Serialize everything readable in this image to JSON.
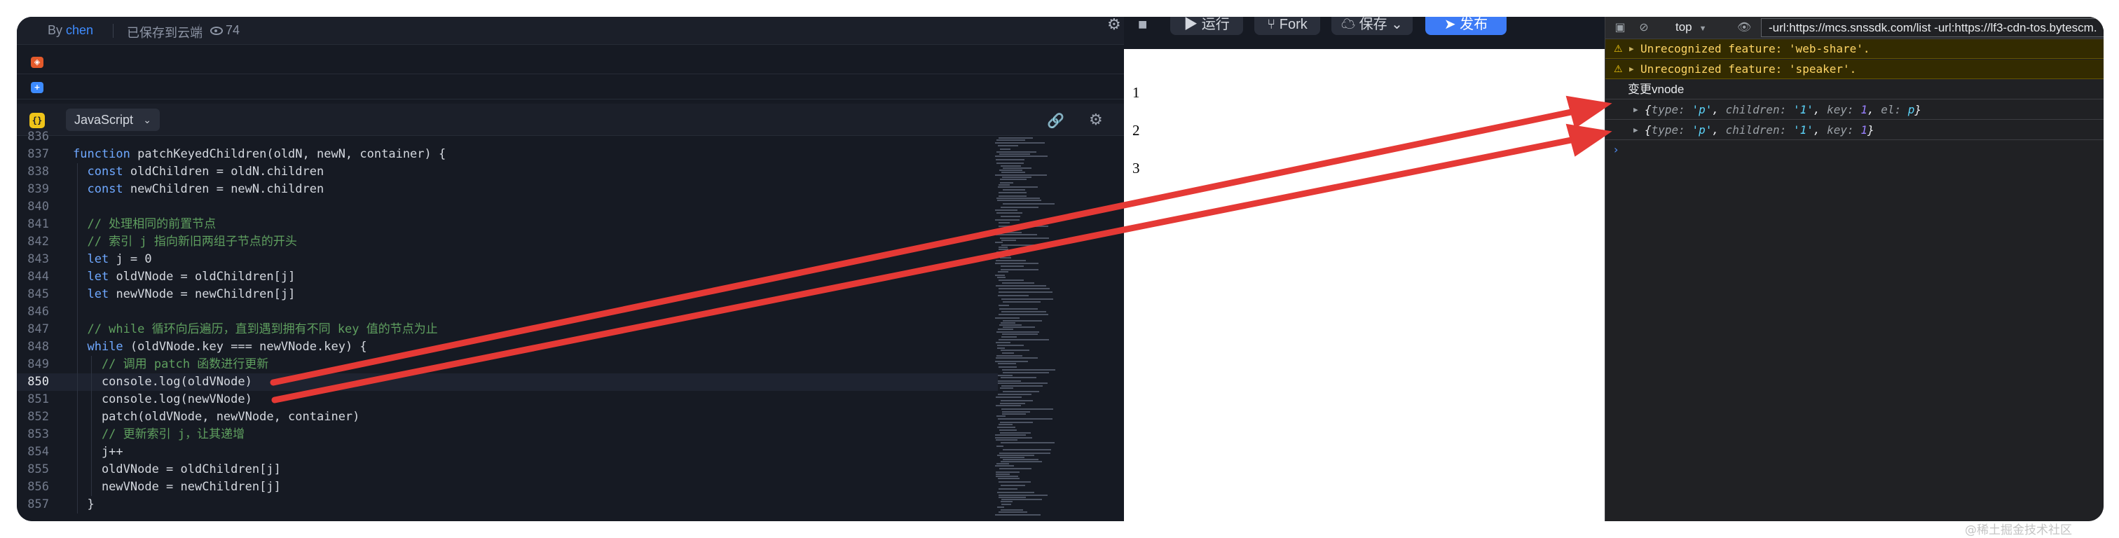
{
  "editor": {
    "by_prefix": "By",
    "author": "chen",
    "saved_status": "已保存到云端",
    "view_count": "74",
    "language": "JavaScript"
  },
  "toolbar": {
    "run_label": "运行",
    "fork_label": "Fork",
    "save_label": "保存",
    "publish_label": "发布"
  },
  "code": {
    "lines": [
      {
        "n": "836",
        "t": ""
      },
      {
        "n": "837",
        "t": "function patchKeyedChildren(oldN, newN, container) {"
      },
      {
        "n": "838",
        "t": "  const oldChildren = oldN.children"
      },
      {
        "n": "839",
        "t": "  const newChildren = newN.children"
      },
      {
        "n": "840",
        "t": ""
      },
      {
        "n": "841",
        "t": "  // 处理相同的前置节点"
      },
      {
        "n": "842",
        "t": "  // 索引 j 指向新旧两组子节点的开头"
      },
      {
        "n": "843",
        "t": "  let j = 0"
      },
      {
        "n": "844",
        "t": "  let oldVNode = oldChildren[j]"
      },
      {
        "n": "845",
        "t": "  let newVNode = newChildren[j]"
      },
      {
        "n": "846",
        "t": ""
      },
      {
        "n": "847",
        "t": "  // while 循环向后遍历，直到遇到拥有不同 key 值的节点为止"
      },
      {
        "n": "848",
        "t": "  while (oldVNode.key === newVNode.key) {"
      },
      {
        "n": "849",
        "t": "    // 调用 patch 函数进行更新"
      },
      {
        "n": "850",
        "t": "    console.log(oldVNode)"
      },
      {
        "n": "851",
        "t": "    console.log(newVNode)"
      },
      {
        "n": "852",
        "t": "    patch(oldVNode, newVNode, container)"
      },
      {
        "n": "853",
        "t": "    // 更新索引 j，让其递增"
      },
      {
        "n": "854",
        "t": "    j++"
      },
      {
        "n": "855",
        "t": "    oldVNode = oldChildren[j]"
      },
      {
        "n": "856",
        "t": "    newVNode = newChildren[j]"
      },
      {
        "n": "857",
        "t": "  }"
      }
    ]
  },
  "preview": {
    "items": [
      "1",
      "2",
      "3"
    ]
  },
  "devtools": {
    "context": "top",
    "filter": "-url:https://mcs.snssdk.com/list -url:https://lf3-cdn-tos.bytescm.",
    "warnings": [
      "Unrecognized feature: 'web-share'.",
      "Unrecognized feature: 'speaker'."
    ],
    "log_label": "变更vnode",
    "obj1": {
      "open": "{",
      "k1": "type:",
      "v1": "'p'",
      "k2": "children:",
      "v2": "'1'",
      "k3": "key:",
      "v3": "1",
      "k4": "el:",
      "v4": "p",
      "close": "}"
    },
    "obj2": {
      "open": "{",
      "k1": "type:",
      "v1": "'p'",
      "k2": "children:",
      "v2": "'1'",
      "k3": "key:",
      "v3": "1",
      "close": "}"
    }
  },
  "watermark": "@稀土掘金技术社区",
  "colors": {
    "editor_bg": "#161a23",
    "accent": "#3d7bf6",
    "arrow": "#e53935",
    "devtools_bg": "#202124",
    "warning_bg": "#332b00"
  }
}
